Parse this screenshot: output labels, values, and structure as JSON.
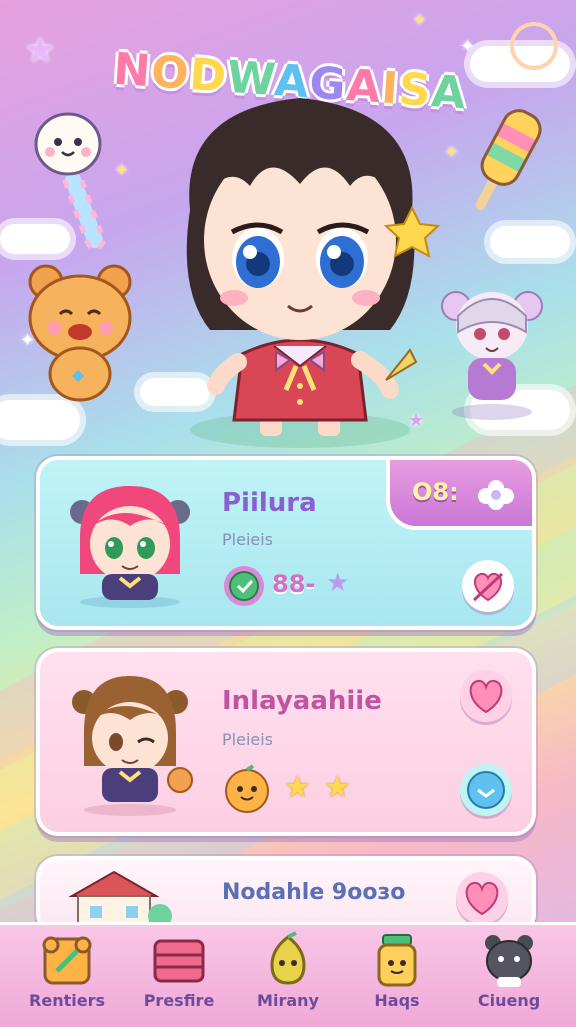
{
  "app": {
    "title": "NODWAGAISA"
  },
  "cards": [
    {
      "title": "Piilura",
      "subtitle": "Pleieis",
      "counter": "O8:",
      "stat": "88-"
    },
    {
      "title": "Inlayaahiie",
      "subtitle": "Pleieis"
    },
    {
      "title": "Nodahle 9ooзo"
    }
  ],
  "nav": {
    "items": [
      {
        "label": "Rentiers",
        "icon": "notebook-icon"
      },
      {
        "label": "Presfire",
        "icon": "treasure-chest-icon"
      },
      {
        "label": "Mirany",
        "icon": "pear-creature-icon"
      },
      {
        "label": "Haqs",
        "icon": "jar-icon"
      },
      {
        "label": "Ciueng",
        "icon": "cat-plush-icon"
      }
    ]
  },
  "colors": {
    "accent": "#c978d6",
    "card1": "#bff4f6",
    "card2": "#fbcfe2",
    "nav": "#f0a9d8"
  }
}
